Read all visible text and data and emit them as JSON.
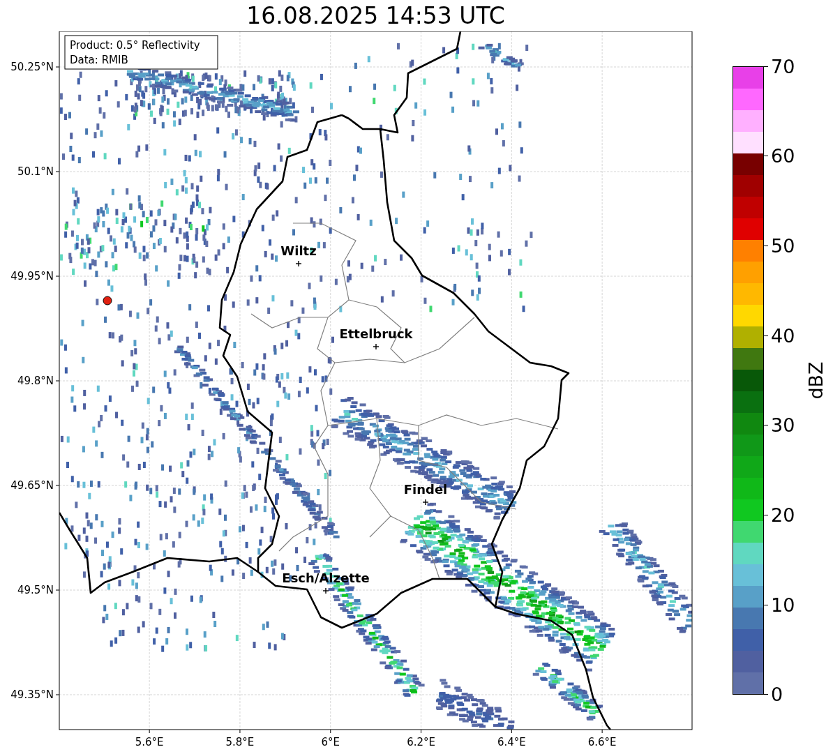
{
  "title": "16.08.2025 14:53 UTC",
  "info_box": [
    "Product: 0.5° Reflectivity",
    "Data: RMIB"
  ],
  "y_ticks": [
    "50.25°N",
    "50.1°N",
    "49.95°N",
    "49.8°N",
    "49.65°N",
    "49.5°N",
    "49.35°N"
  ],
  "x_ticks": [
    "5.6°E",
    "5.8°E",
    "6°E",
    "6.2°E",
    "6.4°E",
    "6.6°E"
  ],
  "cities": [
    {
      "name": "Wiltz"
    },
    {
      "name": "Ettelbruck"
    },
    {
      "name": "Findel"
    },
    {
      "name": "Esch/Alzette"
    }
  ],
  "colorbar": {
    "label": "dBZ",
    "ticks": [
      "70",
      "60",
      "50",
      "40",
      "30",
      "20",
      "10",
      "0"
    ],
    "segments": [
      {
        "color": "#e840e8"
      },
      {
        "color": "#ff68ff"
      },
      {
        "color": "#ffb0ff"
      },
      {
        "color": "#ffe0ff"
      },
      {
        "color": "#780000"
      },
      {
        "color": "#a00000"
      },
      {
        "color": "#c00000"
      },
      {
        "color": "#e00000"
      },
      {
        "color": "#ff8000"
      },
      {
        "color": "#ffa000"
      },
      {
        "color": "#ffb800"
      },
      {
        "color": "#ffd800"
      },
      {
        "color": "#b0b000"
      },
      {
        "color": "#407810"
      },
      {
        "color": "#085808"
      },
      {
        "color": "#0a7010"
      },
      {
        "color": "#108810"
      },
      {
        "color": "#109818"
      },
      {
        "color": "#10a818"
      },
      {
        "color": "#10b818"
      },
      {
        "color": "#10c820"
      },
      {
        "color": "#40d870"
      },
      {
        "color": "#60d8c0"
      },
      {
        "color": "#68c0d8"
      },
      {
        "color": "#58a0c8"
      },
      {
        "color": "#4878b0"
      },
      {
        "color": "#4060a8"
      },
      {
        "color": "#5060a0"
      },
      {
        "color": "#6070a8"
      }
    ]
  }
}
